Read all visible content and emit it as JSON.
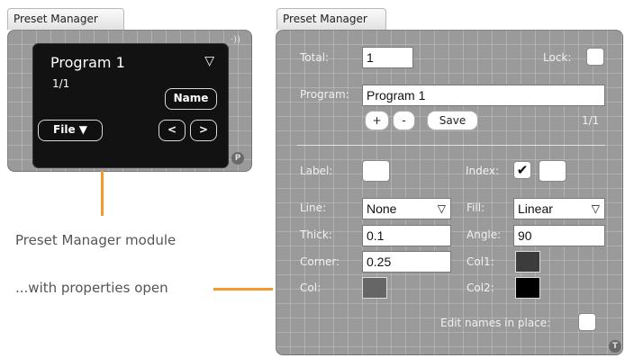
{
  "left_panel": {
    "tab_title": "Preset Manager",
    "program_name": "Program 1",
    "counter": "1/1",
    "name_button": "Name",
    "file_button": "File ▼",
    "prev_button": "<",
    "next_button": ">",
    "menu_arrow": "▽",
    "badge": "P",
    "wave": "·))"
  },
  "captions": {
    "module": "Preset Manager module",
    "properties": "...with properties open"
  },
  "right_panel": {
    "tab_title": "Preset Manager",
    "total_label": "Total:",
    "total_value": "1",
    "lock_label": "Lock:",
    "program_label": "Program:",
    "program_value": "Program 1",
    "plus_button": "+",
    "minus_button": "-",
    "save_button": "Save",
    "counter": "1/1",
    "label_label": "Label:",
    "index_label": "Index:",
    "index_check": "✔",
    "line_label": "Line:",
    "line_value": "None",
    "fill_label": "Fill:",
    "fill_value": "Linear",
    "select_arrow": "▽",
    "thick_label": "Thick:",
    "thick_value": "0.1",
    "angle_label": "Angle:",
    "angle_value": "90",
    "corner_label": "Corner:",
    "corner_value": "0.25",
    "col1_label": "Col1:",
    "col_label": "Col:",
    "col2_label": "Col2:",
    "edit_names_label": "Edit names in place:",
    "badge": "T"
  },
  "colors": {
    "accent_orange": "#f39a2c",
    "col_swatch": "#666666",
    "col1_swatch": "#3c3c3c",
    "col2_swatch": "#000000",
    "panel_grey": "#9a9a9a",
    "screen_black": "#121212"
  }
}
